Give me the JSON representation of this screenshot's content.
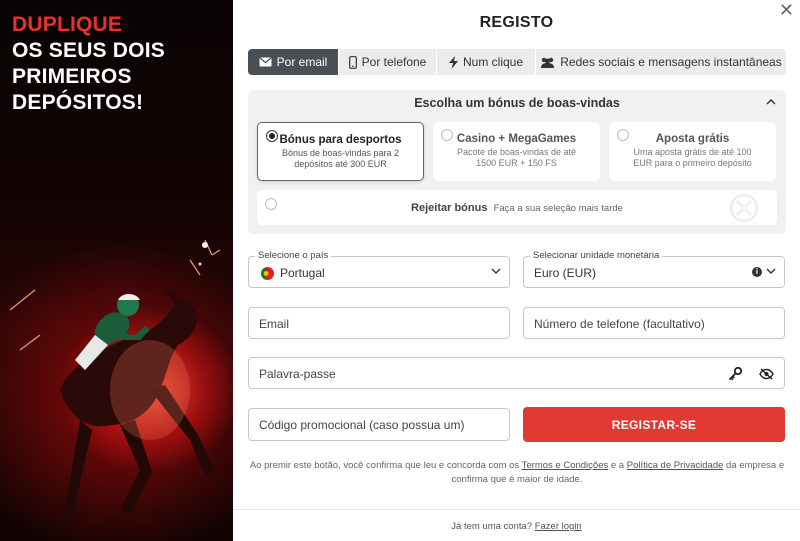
{
  "promo": {
    "line1": "DUPLIQUE",
    "line2": "OS SEUS DOIS",
    "line3": "PRIMEIROS",
    "line4": "DEPÓSITOS!"
  },
  "header": {
    "title": "REGISTO",
    "close": "✕"
  },
  "tabs": [
    {
      "label": "Por email",
      "icon": "envelope-icon",
      "active": true
    },
    {
      "label": "Por telefone",
      "icon": "phone-icon"
    },
    {
      "label": "Num clique",
      "icon": "lightning-icon"
    },
    {
      "label": "Redes sociais e mensagens instantâneas",
      "icon": "users-icon"
    }
  ],
  "bonus": {
    "heading": "Escolha um bónus de boas-vindas",
    "options": [
      {
        "title": "Bónus para desportos",
        "desc": "Bónus de boas-vindas para 2 depósitos até 300 EUR",
        "selected": true
      },
      {
        "title": "Casino + MegaGames",
        "desc": "Pacote de boas-vindas de até 1500 EUR + 150 FS",
        "selected": false
      },
      {
        "title": "Aposta grátis",
        "desc": "Uma aposta grátis de até 100 EUR para o primeiro depósito",
        "selected": false
      }
    ],
    "reject_title": "Rejeitar bónus",
    "reject_sub": "Faça a sua seleção mais tarde"
  },
  "form": {
    "country_label": "Selecione o país",
    "country_value": "Portugal",
    "currency_label": "Selecionar unidade monetária",
    "currency_value": "Euro (EUR)",
    "email_placeholder": "Email",
    "phone_placeholder": "Número de telefone (facultativo)",
    "password_placeholder": "Palavra-passe",
    "promo_placeholder": "Código promocional (caso possua um)",
    "submit_label": "REGISTAR-SE"
  },
  "terms": {
    "pre": "Ao premir este botão, você confirma que leu e concorda com os ",
    "terms_link": "Termos e Condições",
    "mid": " e a ",
    "privacy_link": "Política de Privacidade",
    "post": " da empresa e confirma que é maior de idade."
  },
  "footer": {
    "question": "Já tem uma conta?",
    "login_link": "Fazer login"
  },
  "colors": {
    "accent": "#e23a32",
    "active_tab": "#4a4f55",
    "promo_red": "#e8312f"
  }
}
